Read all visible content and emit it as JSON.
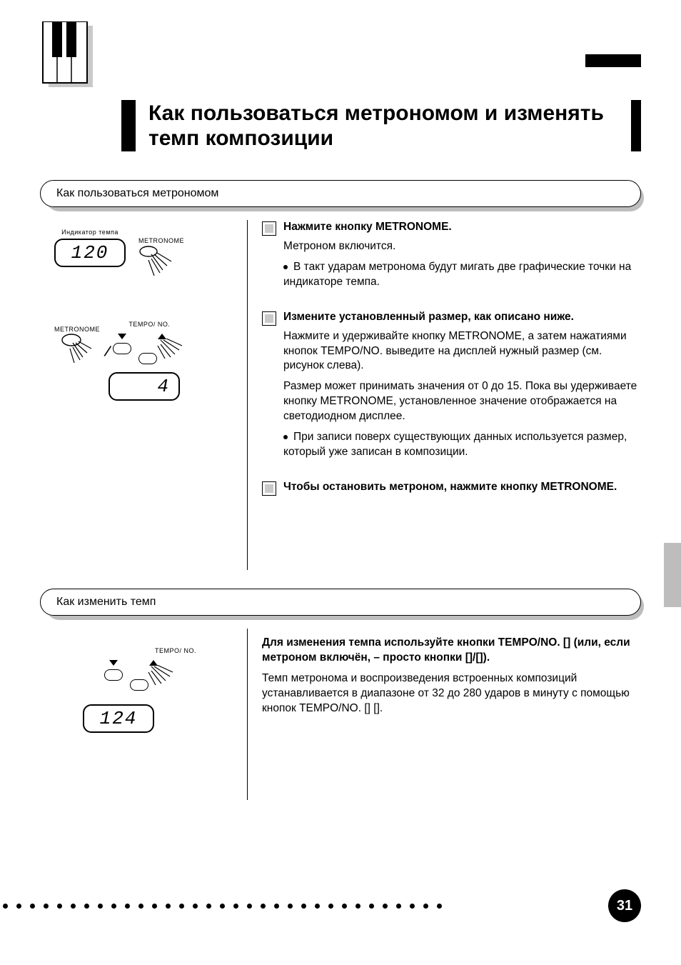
{
  "heading": "Как пользоваться метрономом и изменять темп композиции",
  "section1": {
    "title": "Как пользоваться метрономом",
    "step1": {
      "title": "Нажмите кнопку METRONOME.",
      "para1": "Метроном включится.",
      "para2": "В такт ударам метронома будут мигать две графические точки на индикаторе темпа."
    },
    "step2": {
      "title": "Измените установленный размер, как описано ниже.",
      "para1": "Нажмите и удерживайте кнопку METRONOME, а затем нажатиями кнопок TEMPO/NO. выведите на дисплей нужный размер (см. рисунок слева).",
      "para2": "Размер может принимать значения от 0 до 15. Пока вы удерживаете кнопку METRONOME, установленное значение отображается на светодиодном дисплее.",
      "note": "При записи поверх существующих данных используется размер, который уже записан в композиции."
    },
    "step3": {
      "title": "Чтобы остановить метроном, нажмите кнопку METRONOME.",
      "tempo_label": "Индикатор темпа"
    },
    "icons": {
      "metronome_label": "METRONOME",
      "tempo_no_label": "TEMPO/ NO."
    },
    "lcd1": "120",
    "lcd2": "4"
  },
  "section2": {
    "title": "Как изменить темп",
    "step1": {
      "title": "Для изменения темпа используйте кнопки TEMPO/NO. [] (или, если метроном включён, – просто кнопки []/[]).",
      "para1": "Темп метронома и воспроизведения встроенных композиций устанавливается в диапазоне от 32 до 280 ударов в минуту с помощью кнопок TEMPO/NO. [] []."
    },
    "lcd": "124",
    "tempo_no_label": "TEMPO/ NO."
  },
  "page_number": "31"
}
